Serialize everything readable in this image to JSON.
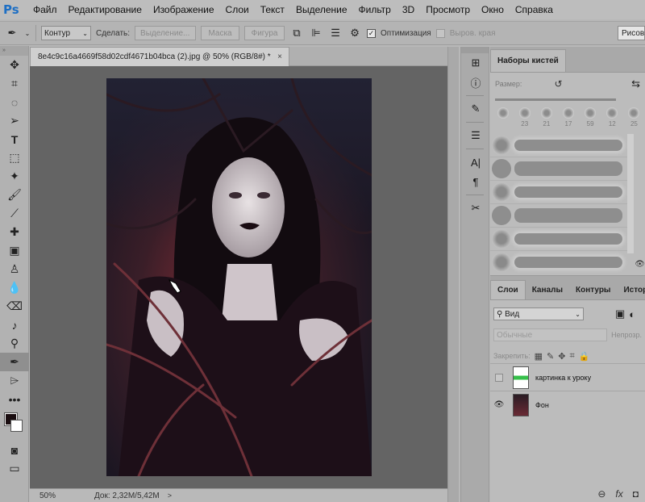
{
  "app": {
    "logo": "Ps"
  },
  "menu": [
    "Файл",
    "Редактирование",
    "Изображение",
    "Слои",
    "Текст",
    "Выделение",
    "Фильтр",
    "3D",
    "Просмотр",
    "Окно",
    "Справка"
  ],
  "options": {
    "mode": "Контур",
    "make_label": "Сделать:",
    "selection_btn": "Выделение...",
    "mask_btn": "Маска",
    "shape_btn": "Фигура",
    "optimize_label": "Оптимизация",
    "align_edges_label": "Выров. края",
    "workspace_btn": "Рисование"
  },
  "document": {
    "tab_title": "8e4c9c16a4669f58d02cdf4671b04bca (2).jpg @ 50% (RGB/8#) *",
    "close": "×"
  },
  "status": {
    "zoom": "50%",
    "doc_info": "Док: 2,32M/5,42M",
    "arrow": ">"
  },
  "brushes_panel": {
    "tab": "Наборы кистей",
    "size_label": "Размер:",
    "presets": [
      "",
      "23",
      "21",
      "17",
      "59",
      "12",
      "25"
    ],
    "strokes": [
      {
        "hard": false
      },
      {
        "hard": true
      },
      {
        "hard": false
      },
      {
        "hard": true
      },
      {
        "hard": false
      },
      {
        "hard": false
      }
    ]
  },
  "layers_panel": {
    "tabs": [
      "Слои",
      "Каналы",
      "Контуры",
      "История"
    ],
    "filter": "Вид",
    "blend_mode": "Обычные",
    "opacity_label": "Непрозр.",
    "lock_label": "Закрепить:",
    "layers": [
      {
        "name": "картинка к уроку",
        "visible": false
      },
      {
        "name": "Фон",
        "visible": true
      }
    ]
  },
  "colors": {
    "foreground": "#1a0d10",
    "background": "#ffffff",
    "photo_accent": "#7a2a32"
  }
}
